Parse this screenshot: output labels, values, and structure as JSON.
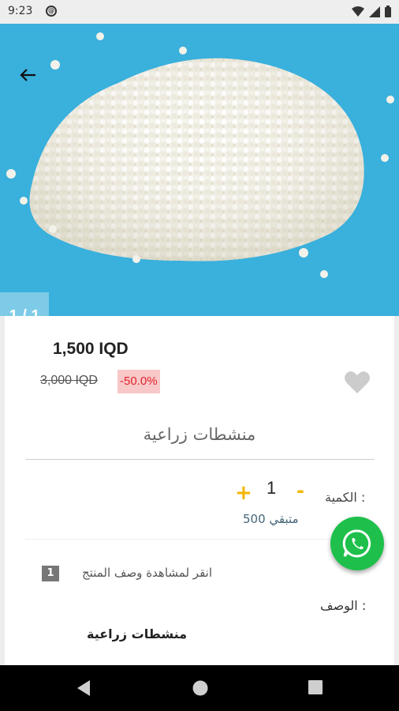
{
  "status": {
    "time": "9:23"
  },
  "product": {
    "page_indicator": "1 / 1",
    "price": "1,500 IQD",
    "old_price": "3,000 IQD",
    "discount": "-50.0%",
    "name": "منشطات زراعية"
  },
  "quantity": {
    "label": "الكمية :",
    "value": "1",
    "plus": "+",
    "minus": "-",
    "stock": "متبقي 500"
  },
  "description": {
    "badge": "1",
    "link_text": "انقر لمشاهدة وصف المنتج",
    "label": "الوصف :",
    "text": "منشطات زراعية"
  },
  "colors": {
    "accent": "#f4b400",
    "whatsapp": "#1ec04b",
    "discount_bg": "#f8c8c8",
    "discount_text": "#e0232e",
    "hero_bg": "#3ab0dc"
  },
  "icons": [
    "back-arrow-icon",
    "heart-icon",
    "whatsapp-icon",
    "nav-back-icon",
    "nav-home-icon",
    "nav-recents-icon",
    "wifi-icon",
    "signal-icon",
    "battery-icon"
  ]
}
